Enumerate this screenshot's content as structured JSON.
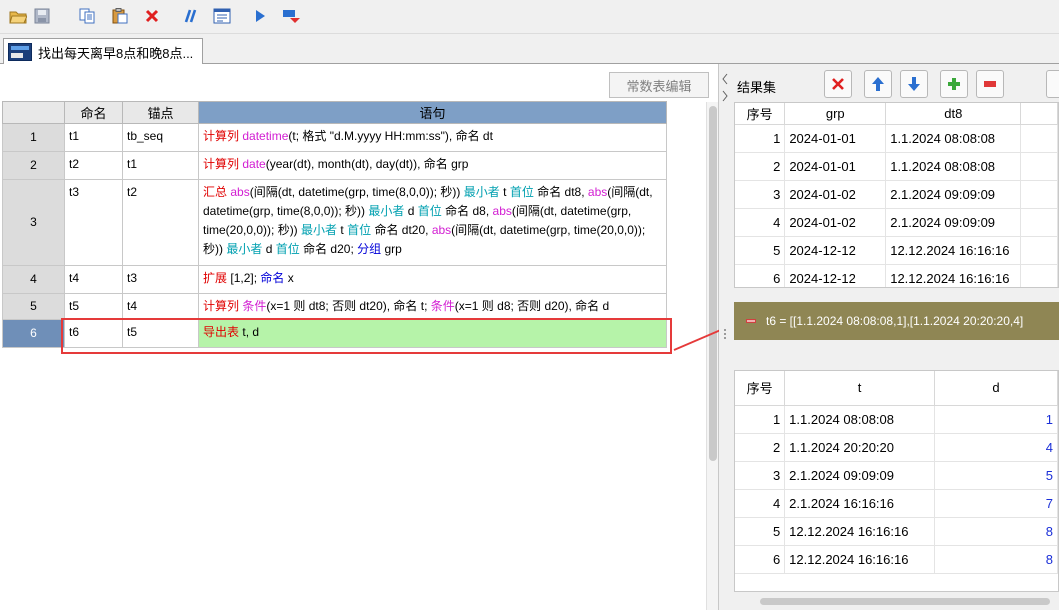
{
  "toolbar": {
    "icons": [
      "open-folder-icon",
      "save-icon",
      "copy-icon",
      "paste-icon",
      "delete-icon",
      "comment-icon",
      "grid-icon",
      "run-icon",
      "step-icon"
    ]
  },
  "tab": {
    "label": "找出每天离早8点和晚8点..."
  },
  "editor": {
    "const_button": "常数表编辑",
    "headers": {
      "name": "命名",
      "anchor": "锚点",
      "statement": "语句"
    },
    "rows": [
      {
        "num": "1",
        "name": "t1",
        "anchor": "tb_seq"
      },
      {
        "num": "2",
        "name": "t2",
        "anchor": "t1"
      },
      {
        "num": "3",
        "name": "t3",
        "anchor": "t2"
      },
      {
        "num": "4",
        "name": "t4",
        "anchor": "t3"
      },
      {
        "num": "5",
        "name": "t5",
        "anchor": "t4"
      },
      {
        "num": "6",
        "name": "t6",
        "anchor": "t5"
      }
    ],
    "stmts": {
      "r1": {
        "k1": "计算列",
        "f1": "datetime",
        "t1": "(t; 格式 \"d.M.yyyy HH:mm:ss\"), 命名 dt"
      },
      "r2": {
        "k1": "计算列",
        "f1": "date",
        "t1": "(year(dt), month(dt), day(dt)), 命名 grp"
      },
      "r3": {
        "k1": "汇总",
        "f1": "abs",
        "t1": "(间隔(dt, datetime(grp, time(8,0,0)); 秒))",
        "m1": "最小者",
        "t2": "t",
        "m2": "首位",
        "t3": "命名 dt8,",
        "f2": "abs",
        "t4": "(间隔(dt, datetime(grp, time(8,0,0)); 秒))",
        "m3": "最小者",
        "t5": "d",
        "m4": "首位",
        "t6": "命名 d8,",
        "f3": "abs",
        "t7": "(间隔(dt, datetime(grp, time(20,0,0)); 秒))",
        "m5": "最小者",
        "t8": "t",
        "m6": "首位",
        "t9": "命名 dt20,",
        "f4": "abs",
        "t10": "(间隔(dt, datetime(grp, time(20,0,0)); 秒))",
        "m7": "最小者",
        "t11": "d",
        "m8": "首位",
        "t12": "命名 d20;",
        "g1": "分组",
        "t13": "grp"
      },
      "r4": {
        "k1": "扩展",
        "t1": "[1,2];",
        "g1": "命名",
        "t2": "x"
      },
      "r5": {
        "k1": "计算列",
        "f1": "条件",
        "t1": "(x=1 则 dt8; 否则 dt20), 命名 t;",
        "f2": "条件",
        "t2": "(x=1 则 d8; 否则 d20), 命名 d"
      },
      "r6": {
        "k1": "导出表",
        "t1": "t, d"
      }
    }
  },
  "results": {
    "title": "结果集",
    "buttons": [
      "delete-icon",
      "arrow-up-icon",
      "arrow-down-icon",
      "plus-icon",
      "minus-icon"
    ],
    "top_table": {
      "headers": [
        "序号",
        "grp",
        "dt8"
      ],
      "rows": [
        [
          "1",
          "2024-01-01",
          "1.1.2024 08:08:08"
        ],
        [
          "2",
          "2024-01-01",
          "1.1.2024 08:08:08"
        ],
        [
          "3",
          "2024-01-02",
          "2.1.2024 09:09:09"
        ],
        [
          "4",
          "2024-01-02",
          "2.1.2024 09:09:09"
        ],
        [
          "5",
          "2024-12-12",
          "12.12.2024 16:16:16"
        ],
        [
          "6",
          "2024-12-12",
          "12.12.2024 16:16:16"
        ]
      ]
    },
    "info_text": "t6 = [[1.1.2024 08:08:08,1],[1.1.2024 20:20:20,4]",
    "bottom_table": {
      "headers": [
        "序号",
        "t",
        "d"
      ],
      "rows": [
        [
          "1",
          "1.1.2024 08:08:08",
          "1"
        ],
        [
          "2",
          "1.1.2024 20:20:20",
          "4"
        ],
        [
          "3",
          "2.1.2024 09:09:09",
          "5"
        ],
        [
          "4",
          "2.1.2024 16:16:16",
          "7"
        ],
        [
          "5",
          "12.12.2024 16:16:16",
          "8"
        ],
        [
          "6",
          "12.12.2024 16:16:16",
          "8"
        ]
      ]
    }
  },
  "colors": {
    "selected_row": "#6f8fb8",
    "header_blue": "#7e9fc6",
    "green_cell": "#b6f3a9",
    "info_bar": "#8f8654",
    "highlight_red": "#e53a3a"
  }
}
